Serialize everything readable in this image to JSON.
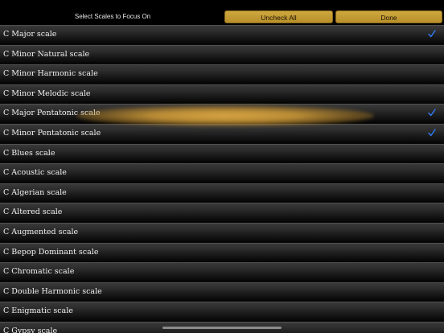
{
  "header": {
    "title": "Select Scales to Focus On",
    "uncheck_all_label": "Uncheck All",
    "done_label": "Done"
  },
  "colors": {
    "button_gold": "#cfa83f",
    "check_blue": "#2f7cf6",
    "highlight_gold": "#e2ac46"
  },
  "check_icon": "checkmark-icon",
  "scales": [
    {
      "label": "C Major scale",
      "checked": true
    },
    {
      "label": "C Minor Natural scale",
      "checked": false
    },
    {
      "label": "C Minor Harmonic scale",
      "checked": false
    },
    {
      "label": "C Minor Melodic scale",
      "checked": false
    },
    {
      "label": "C Major Pentatonic scale",
      "checked": true
    },
    {
      "label": "C Minor Pentatonic scale",
      "checked": true
    },
    {
      "label": "C Blues scale",
      "checked": false
    },
    {
      "label": "C Acoustic scale",
      "checked": false
    },
    {
      "label": "C Algerian scale",
      "checked": false
    },
    {
      "label": "C Altered scale",
      "checked": false
    },
    {
      "label": "C Augmented scale",
      "checked": false
    },
    {
      "label": "C Bepop Dominant scale",
      "checked": false
    },
    {
      "label": "C Chromatic scale",
      "checked": false
    },
    {
      "label": "C Double Harmonic scale",
      "checked": false
    },
    {
      "label": "C Enigmatic scale",
      "checked": false
    },
    {
      "label": "C Gypsy scale",
      "checked": false
    }
  ]
}
